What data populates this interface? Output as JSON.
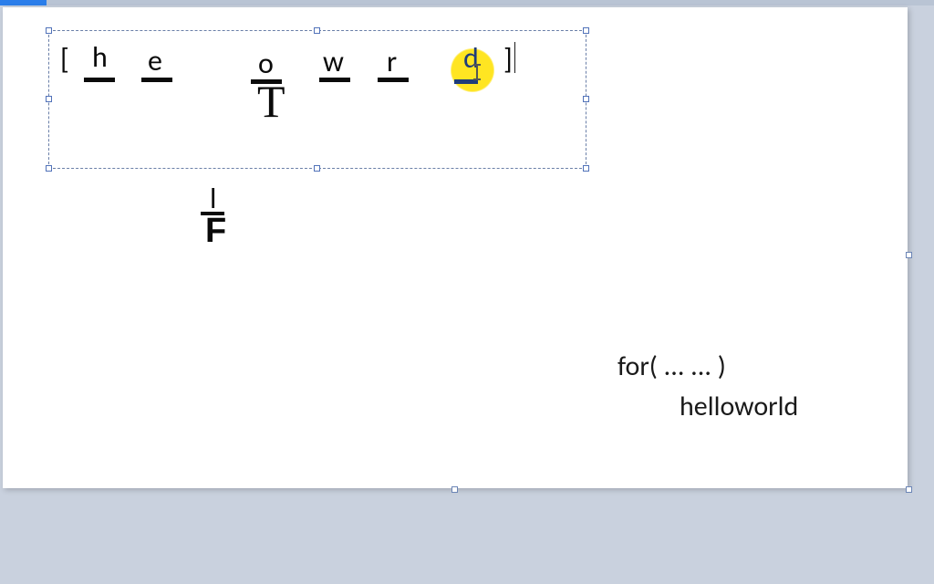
{
  "colors": {
    "background": "#c9d1de",
    "page": "#ffffff",
    "selection": "#6a7fa8",
    "highlight": "#ffe522",
    "accent_letter": "#1f3c7a"
  },
  "textbox": {
    "bracket_open": "[",
    "bracket_close": "]",
    "letters": [
      "h",
      "e",
      "o",
      "w",
      "r",
      "d"
    ],
    "pointer_glyph": "T",
    "highlighted_letter_index": 5
  },
  "pointer2": {
    "top_letter": "l",
    "glyph": "F"
  },
  "code": {
    "line1": "for( ... ... )",
    "line2": "helloworld"
  }
}
